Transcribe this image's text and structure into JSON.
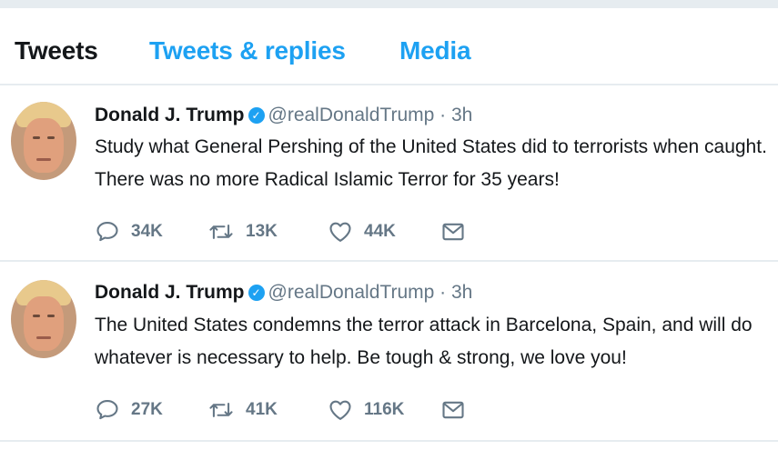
{
  "tabs": [
    {
      "label": "Tweets"
    },
    {
      "label": "Tweets & replies"
    },
    {
      "label": "Media"
    }
  ],
  "tweets": [
    {
      "name": "Donald J. Trump",
      "handle": "@realDonaldTrump",
      "sep": "·",
      "time": "3h",
      "text": "Study what General Pershing of the United States did to terrorists when caught. There was no more Radical Islamic Terror for 35 years!",
      "replies": "34K",
      "retweets": "13K",
      "likes": "44K"
    },
    {
      "name": "Donald J. Trump",
      "handle": "@realDonaldTrump",
      "sep": "·",
      "time": "3h",
      "text": "The United States condemns the terror attack in Barcelona, Spain, and will do whatever is necessary to help. Be tough & strong, we love you!",
      "replies": "27K",
      "retweets": "41K",
      "likes": "116K"
    }
  ],
  "colors": {
    "accent": "#1da1f2",
    "muted": "#657786",
    "text": "#14171a",
    "divider": "#e6ecf0"
  },
  "icons": {
    "reply": "reply-icon",
    "retweet": "retweet-icon",
    "like": "heart-icon",
    "message": "envelope-icon",
    "verified": "verified-badge-icon"
  }
}
